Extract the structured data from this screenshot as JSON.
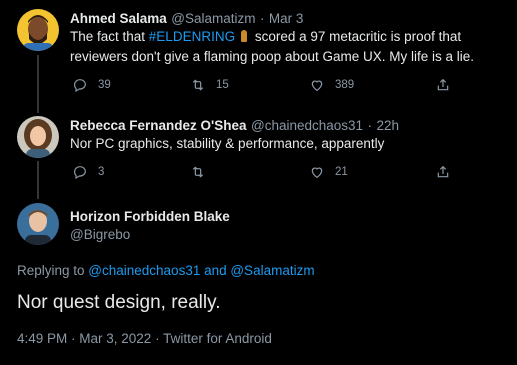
{
  "colors": {
    "accent": "#1d9bf0",
    "bg": "#000000",
    "muted": "#8b98a5"
  },
  "tweets": [
    {
      "name": "Ahmed Salama",
      "handle": "@Salamatizm",
      "dot": "·",
      "date": "Mar 3",
      "text_before": "The fact that ",
      "hashtag": "#ELDENRING",
      "text_after": " scored a 97 metacritic is proof that reviewers don't give a flaming poop about Game UX. My life is a lie.",
      "replies": "39",
      "retweets": "15",
      "likes": "389"
    },
    {
      "name": "Rebecca Fernandez O'Shea",
      "handle": "@chainedchaos31",
      "dot": "·",
      "date": "22h",
      "text": "Nor PC graphics, stability & performance, apparently",
      "replies": "3",
      "retweets": "",
      "likes": "21"
    }
  ],
  "main_tweet": {
    "name": "Horizon Forbidden Blake",
    "handle": "@Bigrebo",
    "replying_prefix": "Replying to ",
    "replying_users": "@chainedchaos31 and @Salamatizm",
    "text": "Nor quest design, really.",
    "timestamp": "4:49 PM · Mar 3, 2022 · Twitter for Android"
  }
}
